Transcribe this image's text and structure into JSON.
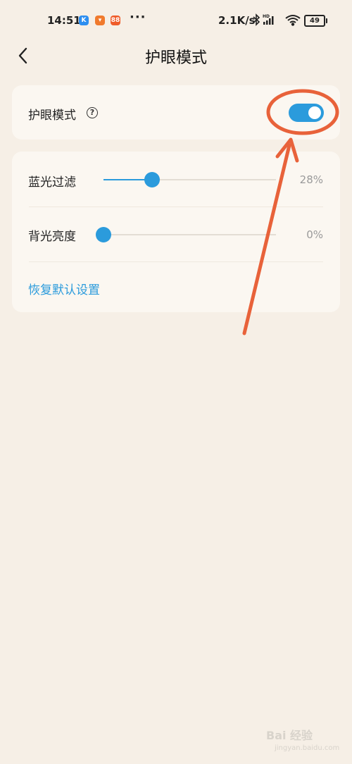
{
  "status_bar": {
    "time": "14:51",
    "net_speed": "2.1K/s",
    "battery": "49",
    "app_icons": [
      {
        "name": "k-app-icon",
        "glyph": "K",
        "color": "#2d8ef0"
      },
      {
        "name": "shop-app-icon",
        "glyph": "◡",
        "color": "#f07a2d"
      },
      {
        "name": "grid-app-icon",
        "glyph": "88",
        "color": "#ef5c2a"
      }
    ]
  },
  "header": {
    "title": "护眼模式"
  },
  "eye_mode": {
    "label": "护眼模式",
    "help_glyph": "?",
    "enabled": true
  },
  "settings": {
    "blue_filter": {
      "label": "蓝光过滤",
      "value_text": "28%",
      "value": 0.28
    },
    "backlight": {
      "label": "背光亮度",
      "value_text": "0%",
      "value": 0.0
    },
    "reset_label": "恢复默认设置"
  },
  "colors": {
    "accent": "#2b9bdc",
    "annotation": "#e8623a",
    "background": "#f6efe6"
  },
  "watermark": {
    "main": "Bai 经验",
    "sub": "jingyan.baidu.com"
  }
}
